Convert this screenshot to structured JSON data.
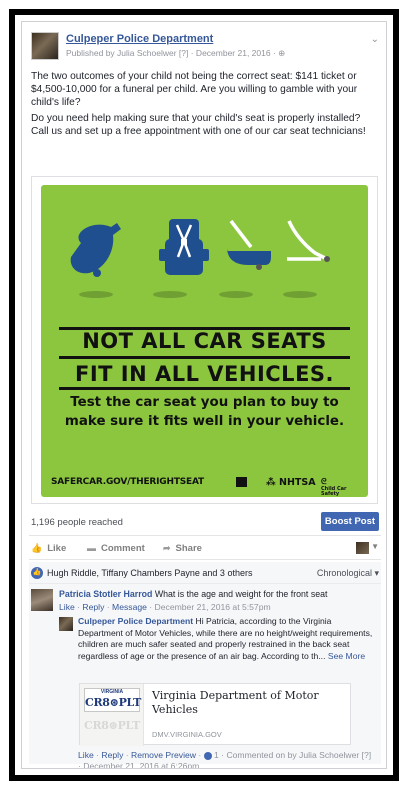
{
  "post": {
    "page_name": "Culpeper Police Department",
    "published_by": "Published by Julia Schoelwer [?] · December 21, 2016 · ⊕",
    "paragraph1": "The two outcomes of your child not being the correct seat: $141 ticket or $4,500-10,000 for a funeral per child. Are you willing to gamble with your child's life?",
    "paragraph2": "Do you need help making sure that your child's seat is properly installed? Call us and set up a free appointment with one of our car seat technicians!"
  },
  "image": {
    "headline_line1": "NOT ALL CAR SEATS",
    "headline_line2": "FIT IN ALL VEHICLES.",
    "subtext": "Test the car seat you plan to buy to make sure it fits well in your vehicle.",
    "url": "SAFERCAR.GOV/THERIGHTSEAT",
    "nhtsa": "NHTSA",
    "childcar": "Child Car Safety",
    "bg_color": "#8cc63f",
    "icon_color": "#1f4f8f"
  },
  "stats": {
    "reach": "1,196 people reached",
    "boost_label": "Boost Post"
  },
  "actions": {
    "like": "Like",
    "comment": "Comment",
    "share": "Share"
  },
  "likes": {
    "likers": "Hugh Riddle, Tiffany Chambers Payne and 3 others",
    "order": "Chronological"
  },
  "comment1": {
    "author": "Patricia Stotler Harrod",
    "text": "What is the age and weight for the front seat",
    "like": "Like",
    "reply": "Reply",
    "message": "Message",
    "time": "December 21, 2016 at 5:57pm"
  },
  "reply1": {
    "author": "Culpeper Police Department",
    "text": "Hi Patricia, according to the Virginia Department of Motor Vehicles, while there are no height/weight requirements, children are much safer seated and properly restrained in the back seat regardless of age or the presence of an air bag. According to th...",
    "see_more": "See More",
    "preview_title": "Virginia Department of Motor Vehicles",
    "preview_domain": "DMV.VIRGINIA.GOV",
    "plate_state": "VIRGINIA",
    "plate_number": "CR8⊛PLT",
    "like": "Like",
    "reply": "Reply",
    "remove_preview": "Remove Preview",
    "like_count": "1",
    "commented_on_by": "Commented on by Julia Schoelwer [?] · December 21, 2016 at 6:26pm"
  }
}
